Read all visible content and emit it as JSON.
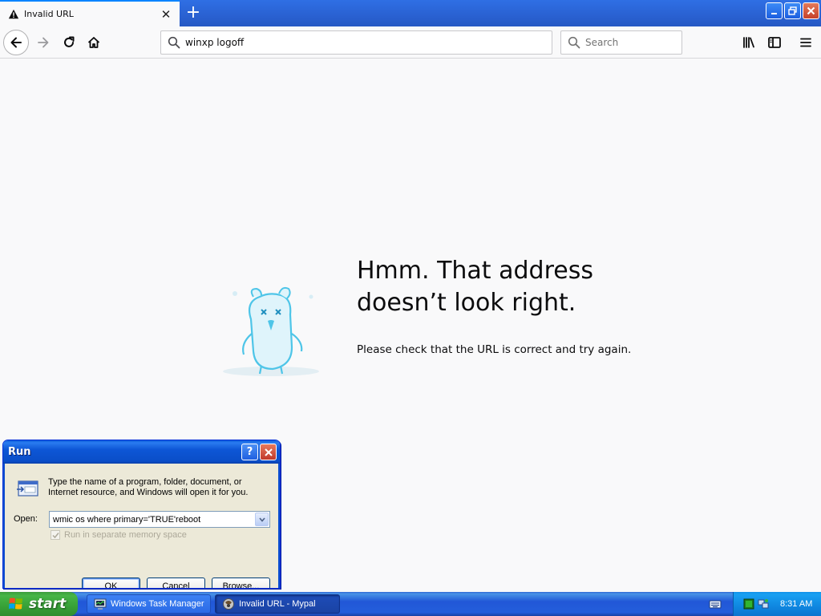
{
  "browser": {
    "tab": {
      "title": "Invalid URL",
      "icon": "warning-icon"
    },
    "address": {
      "value": "winxp logoff"
    },
    "search": {
      "placeholder": "Search"
    }
  },
  "error_page": {
    "title_line1": "Hmm. That address",
    "title_line2": "doesn’t look right.",
    "description": "Please check that the URL is correct and try again."
  },
  "run_dialog": {
    "title": "Run",
    "description": "Type the name of a program, folder, document, or Internet resource, and Windows will open it for you.",
    "open_label": "Open:",
    "open_value": "wmic os where primary='TRUE'reboot",
    "checkbox_label": "Run in separate memory space",
    "checkbox_checked": true,
    "ok_label": "OK",
    "cancel_label": "Cancel",
    "browse_label": "Browse..."
  },
  "taskbar": {
    "start_label": "start",
    "buttons": [
      {
        "label": "Windows Task Manager",
        "icon": "task-manager-icon"
      },
      {
        "label": "Invalid URL - Mypal",
        "icon": "mypal-icon",
        "active": true
      }
    ],
    "clock": "8:31 AM"
  },
  "colors": {
    "accent": "#0a84ff",
    "xp_blue": "#245edb",
    "start_green": "#37a137"
  }
}
